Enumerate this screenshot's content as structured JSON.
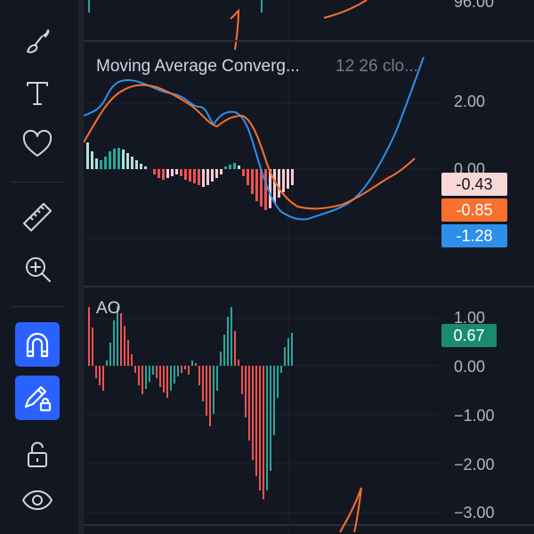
{
  "toolbar": {
    "tools": [
      {
        "name": "brush-tool",
        "icon": "brush-icon"
      },
      {
        "name": "text-tool",
        "icon": "text-icon"
      },
      {
        "name": "favorites-tool",
        "icon": "heart-icon"
      },
      {
        "name": "ruler-tool",
        "icon": "ruler-icon"
      },
      {
        "name": "zoom-tool",
        "icon": "zoom-in-icon"
      },
      {
        "name": "magnet-tool",
        "icon": "magnet-icon",
        "active": true
      },
      {
        "name": "lock-drawings-tool",
        "icon": "pencil-lock-icon",
        "active": true
      },
      {
        "name": "unlock-tool",
        "icon": "unlock-icon"
      },
      {
        "name": "visibility-tool",
        "icon": "eye-icon"
      }
    ]
  },
  "price_pane": {
    "top_axis_label": "96.00"
  },
  "macd_pane": {
    "title": "Moving Average Converg...",
    "params": "12 26 clo...",
    "axis_labels": [
      "2.00",
      "0.00"
    ],
    "tags": {
      "histogram": {
        "value": "-0.43",
        "bg": "#f8d7d7",
        "fg": "#131722"
      },
      "signal": {
        "value": "-0.85",
        "bg": "#f7702d",
        "fg": "#ffffff"
      },
      "macd": {
        "value": "-1.28",
        "bg": "#2e8fea",
        "fg": "#ffffff"
      }
    }
  },
  "ao_pane": {
    "title": "AO",
    "axis_labels": [
      "1.00",
      "0.00",
      "−1.00",
      "−2.00",
      "−3.00"
    ],
    "tag": {
      "value": "0.67",
      "bg": "#1a8b6e",
      "fg": "#ffffff"
    }
  },
  "colors": {
    "background": "#131722",
    "macd_line": "#2e8fea",
    "signal_line": "#f7702d",
    "hist_up_strong": "#26a69a",
    "hist_up_weak": "#b2dfdb",
    "hist_down_strong": "#ef5350",
    "hist_down_weak": "#ffcdd2",
    "accent": "#2962ff"
  }
}
